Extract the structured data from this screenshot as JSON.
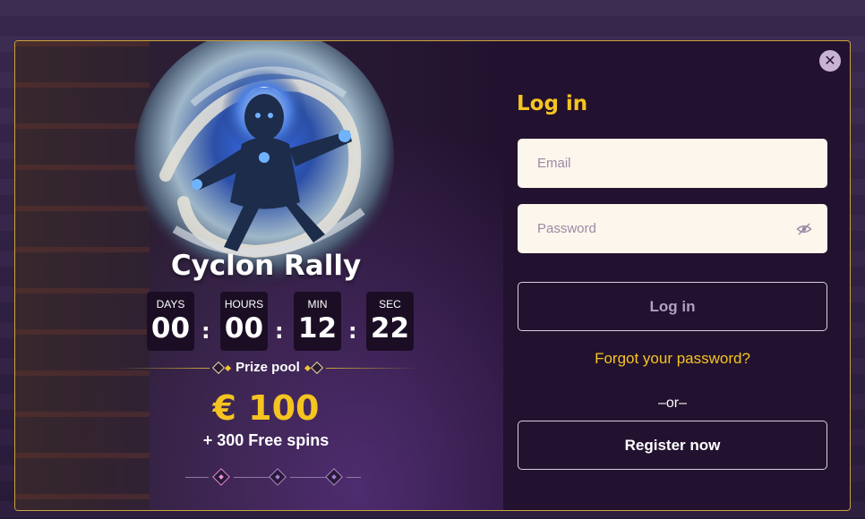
{
  "promo": {
    "title": "Cyclon Rally",
    "timer": [
      {
        "label": "DAYS",
        "value": "00"
      },
      {
        "label": "HOURS",
        "value": "00"
      },
      {
        "label": "MIN",
        "value": "12"
      },
      {
        "label": "SEC",
        "value": "22"
      }
    ],
    "separator": ":",
    "prize_label": "Prize pool",
    "prize_amount": "€ 100",
    "prize_extra": "+ 300 Free spins",
    "pager_count": 3,
    "pager_active": 0
  },
  "login": {
    "title": "Log in",
    "email_placeholder": "Email",
    "password_placeholder": "Password",
    "login_button": "Log in",
    "forgot_link": "Forgot your password?",
    "or_text": "–or–",
    "register_button": "Register now"
  },
  "icons": {
    "close": "close-icon",
    "password_visibility": "eye-slash-icon"
  },
  "colors": {
    "accent": "#f5c421",
    "modal_bg": "#22122f",
    "border": "#c9a43a",
    "input_bg": "#fdf6ec"
  }
}
